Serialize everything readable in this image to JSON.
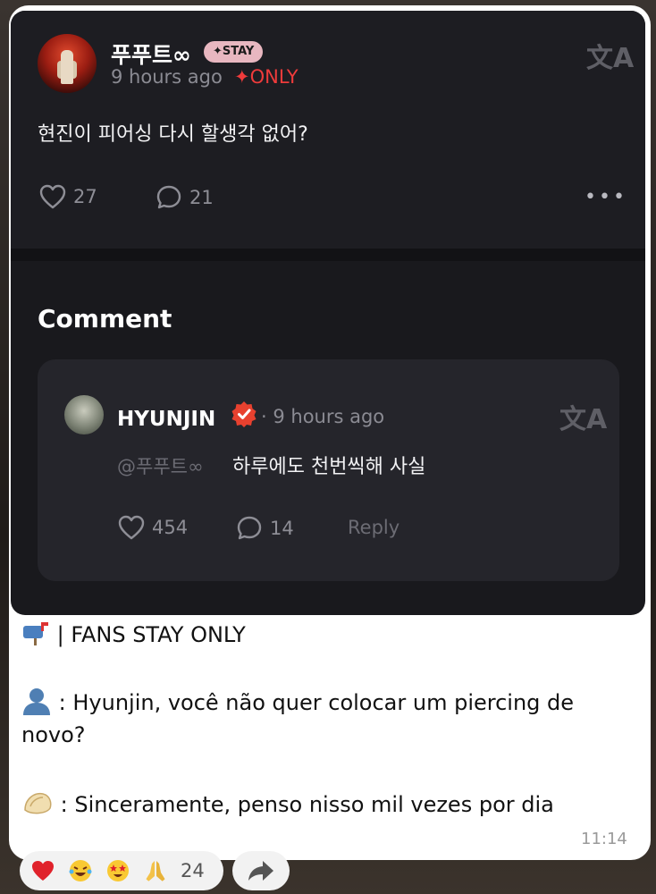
{
  "post": {
    "author_name": "푸푸트∞",
    "badge": "✦STAY",
    "time": "9 hours ago",
    "only_label": "✦ONLY",
    "text": "현진이 피어싱 다시 할생각 없어?",
    "likes": "27",
    "comments": "21",
    "more": "•••"
  },
  "comment_section": {
    "heading": "Comment",
    "author": "HYUNJIN",
    "time": "· 9 hours ago",
    "mention": "@푸푸트∞",
    "text": "하루에도 천번씩해 사실",
    "likes": "454",
    "replies": "14",
    "reply_label": "Reply"
  },
  "translate_icon": "文A",
  "caption": {
    "line1": "| FANS STAY ONLY",
    "line2a": ": Hyunjin, você não quer colocar um piercing de",
    "line2b": "novo?",
    "line3": ": Sinceramente, penso nisso mil vezes por dia"
  },
  "message_time": "11:14",
  "reactions": {
    "count": "24",
    "icons": [
      "heart-emoji",
      "laughing-emoji",
      "star-struck-emoji",
      "folded-hands-emoji"
    ]
  },
  "colors": {
    "only_red": "#ef3b3b",
    "badge_pink": "#e8b7c0",
    "verified_red": "#e8412f"
  }
}
